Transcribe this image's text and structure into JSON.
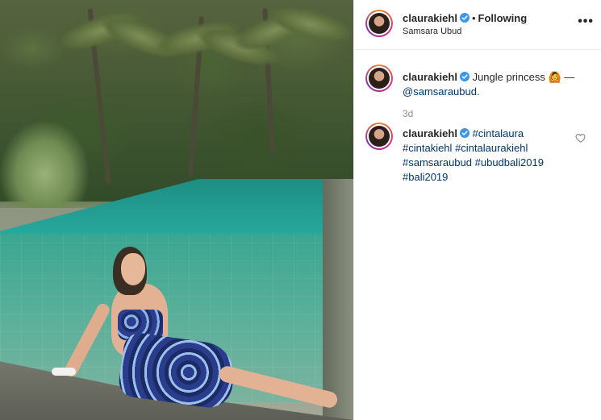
{
  "post": {
    "photo_alt": "",
    "author": {
      "username": "claurakiehl",
      "verified": true,
      "follow_status": "Following",
      "location": "Samsara Ubud"
    },
    "more_label": "•••",
    "caption": {
      "username": "claurakiehl",
      "text": "Jungle princess 🙆 —",
      "mention": "@samsaraubud.",
      "time": "3d"
    },
    "comments": [
      {
        "username": "claurakiehl",
        "hashtags": [
          "#cintalaura",
          "#cintakiehl",
          "#cintalaurakiehl",
          "#samsaraubud",
          "#ubudbali2019",
          "#bali2019"
        ]
      }
    ]
  },
  "colors": {
    "link": "#003569",
    "verified_badge": "#3897f0",
    "muted": "#8e8e8e",
    "border": "#efefef"
  },
  "icons": {
    "verified": "verified-badge-icon",
    "more": "more-options-icon",
    "like": "heart-icon"
  }
}
